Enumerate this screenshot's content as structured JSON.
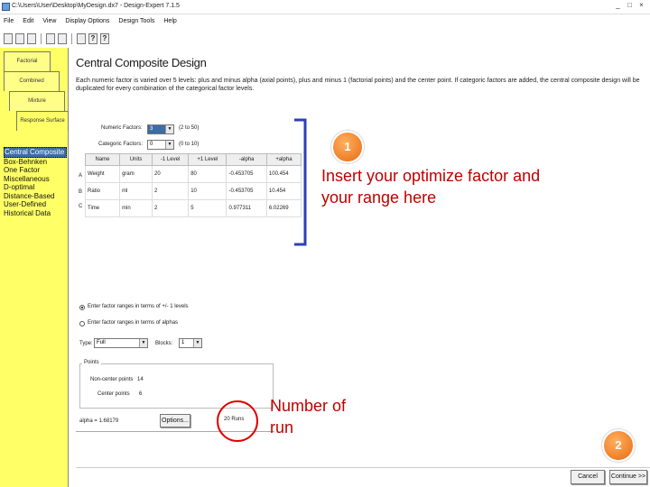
{
  "window": {
    "title": "C:\\Users\\User\\Desktop\\MyDesign.dx7 - Design-Expert 7.1.5",
    "controls": [
      "_",
      "□",
      "×"
    ]
  },
  "menu": [
    "File",
    "Edit",
    "View",
    "Display Options",
    "Design Tools",
    "Help"
  ],
  "toolbar": {
    "help_label": "?",
    "whatsthis_label": "?"
  },
  "sidebar": {
    "tabs": [
      "Factorial",
      "Combined",
      "Mixture",
      "Response Surface"
    ],
    "designs": [
      "Central Composite",
      "Box-Behnken",
      "One Factor",
      "Miscellaneous",
      "D-optimal",
      "Distance-Based",
      "User-Defined",
      "Historical Data"
    ],
    "selected_index": 0
  },
  "main": {
    "title": "Central Composite Design",
    "description": "Each numeric factor is varied over 5 levels: plus and minus alpha (axial points), plus and minus 1 (factorial points) and the center point. If categoric factors are added, the central composite design will be duplicated for every combination of the categorical factor levels.",
    "numeric_factors": {
      "label": "Numeric Factors:",
      "value": "3",
      "range": "(2 to 50)"
    },
    "categoric_factors": {
      "label": "Categoric Factors:",
      "value": "0",
      "range": "(0 to 10)"
    },
    "table": {
      "headers": [
        "Name",
        "Units",
        "-1 Level",
        "+1 Level",
        "-alpha",
        "+alpha"
      ],
      "row_markers": [
        "A",
        "B",
        "C"
      ],
      "rows": [
        [
          "Weight",
          "gram",
          "20",
          "80",
          "-0.453705",
          "100.454"
        ],
        [
          "Ratio",
          "ml",
          "2",
          "10",
          "-0.453705",
          "10.454"
        ],
        [
          "Time",
          "min",
          "2",
          "5",
          "0.977311",
          "6.02269"
        ]
      ]
    },
    "range_options": [
      "Enter factor ranges in terms of +/- 1 levels",
      "Enter factor ranges in terms of alphas"
    ],
    "range_option_selected": 0,
    "type": {
      "label": "Type:",
      "value": "Full"
    },
    "blocks": {
      "label": "Blocks:",
      "value": "1"
    },
    "points": {
      "legend": "Points",
      "noncenter_label": "Non-center points",
      "noncenter_value": "14",
      "center_label": "Center points",
      "center_value": "6"
    },
    "alpha_text": "alpha = 1.68179",
    "options_button": "Options...",
    "runs_text": "20 Runs",
    "cancel_button": "Cancel",
    "continue_button": "Continue >>"
  },
  "annotations": {
    "step1_number": "1",
    "step1_text_line1": "Insert your optimize factor and",
    "step1_text_line2": "your range here",
    "runs_text_line1": "Number of",
    "runs_text_line2": "run",
    "step2_number": "2",
    "accent_color": "#c00000",
    "bracket_color": "#2f3fb8"
  }
}
